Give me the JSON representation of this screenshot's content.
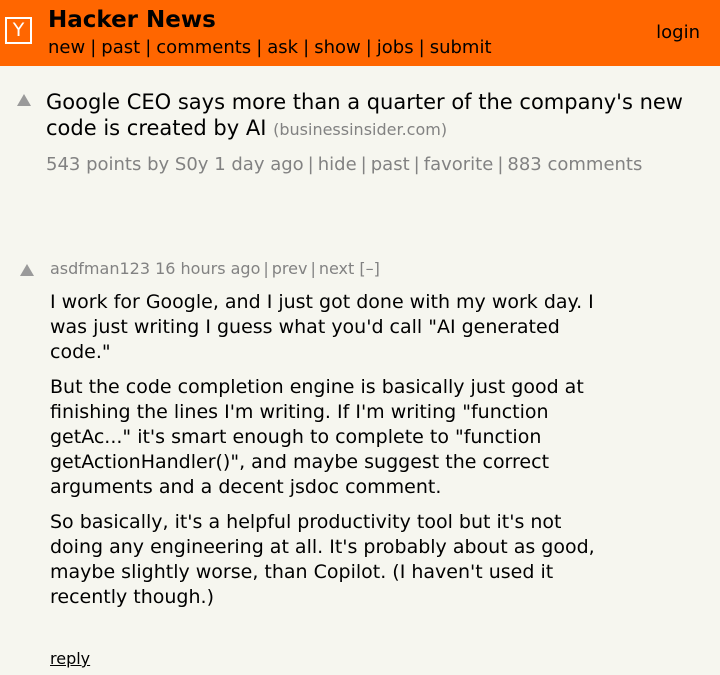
{
  "header": {
    "logo_letter": "Y",
    "site_title": "Hacker News",
    "nav": [
      "new",
      "past",
      "comments",
      "ask",
      "show",
      "jobs",
      "submit"
    ],
    "separator": "|",
    "login": "login",
    "background_color": "#ff6600"
  },
  "story": {
    "title": "Google CEO says more than a quarter of the company's new code is created by AI",
    "site": "(businessinsider.com)",
    "points": "543 points",
    "by": "by",
    "user": "S0y",
    "age": "1 day ago",
    "actions": [
      "hide",
      "past",
      "favorite",
      "883 comments"
    ]
  },
  "comment": {
    "user": "asdfman123",
    "age": "16 hours ago",
    "prev": "prev",
    "next": "next",
    "toggle": "[–]",
    "paragraphs": [
      "I work for Google, and I just got done with my work day. I was just writing I guess what you'd call \"AI generated code.\"",
      "But the code completion engine is basically just good at finishing the lines I'm writing. If I'm writing \"function getAc...\" it's smart enough to complete to \"function getActionHandler()\", and maybe suggest the correct arguments and a decent jsdoc comment.",
      "So basically, it's a helpful productivity tool but it's not doing any engineering at all. It's probably about as good, maybe slightly worse, than Copilot. (I haven't used it recently though.)"
    ],
    "reply": "reply"
  }
}
